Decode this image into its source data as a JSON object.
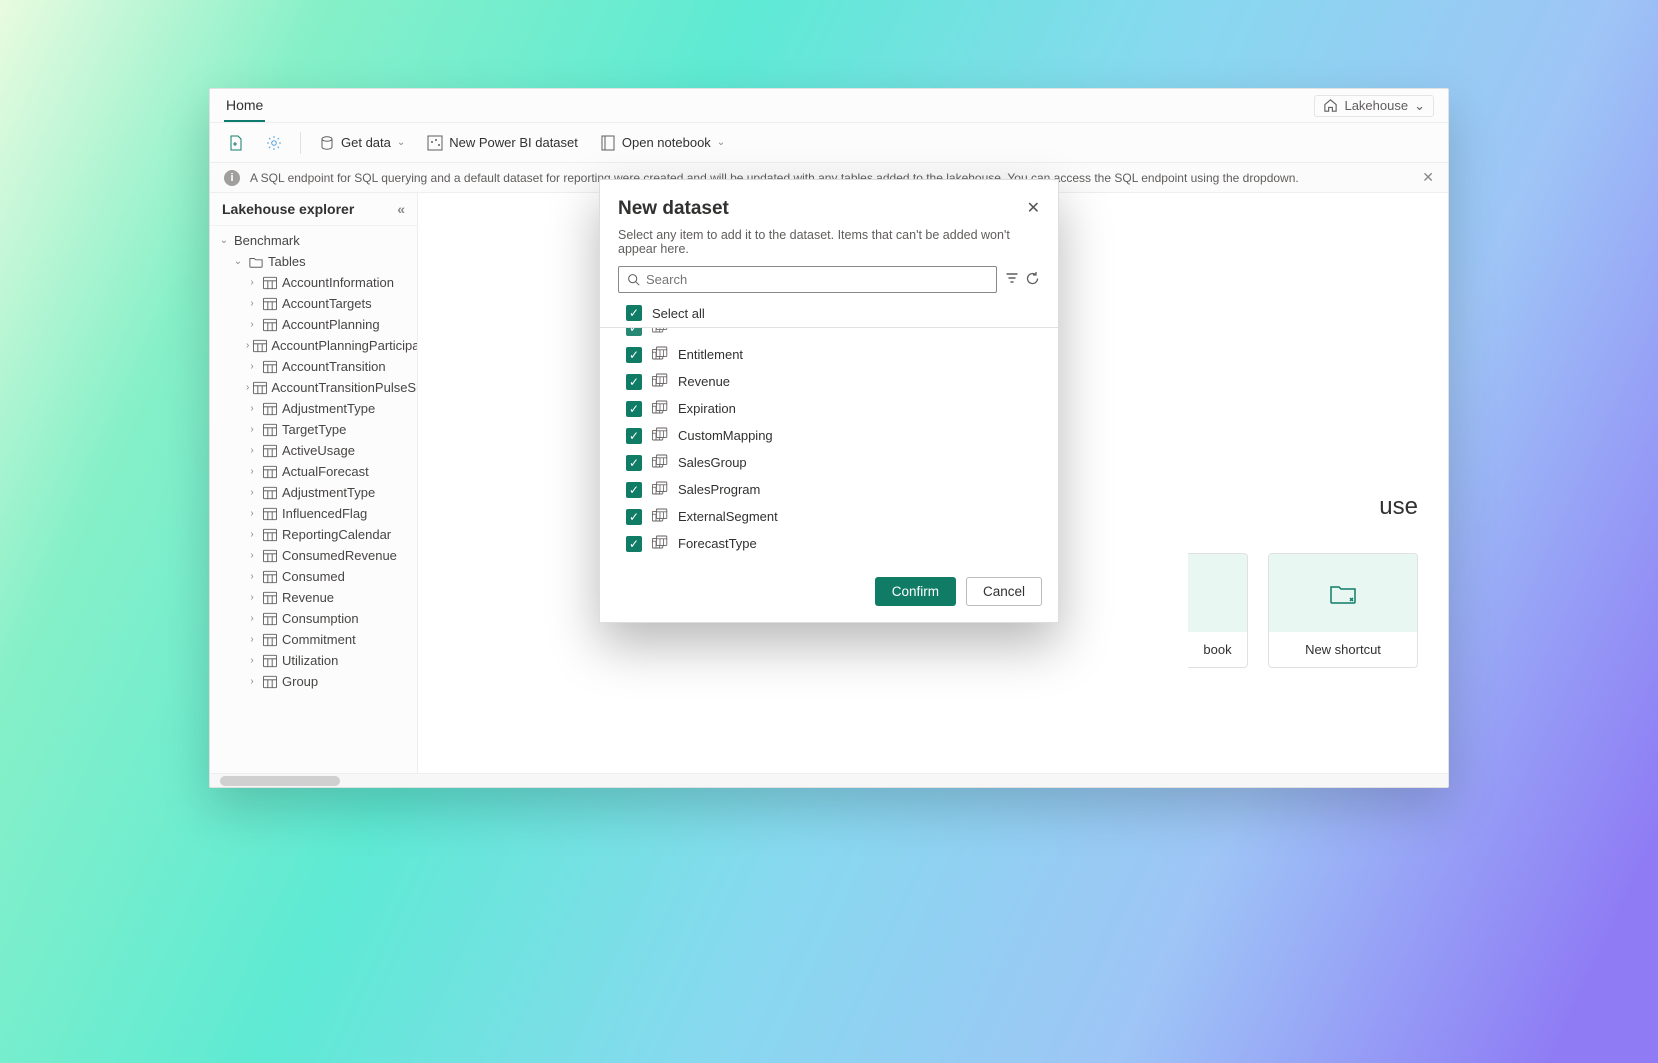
{
  "tabs": {
    "home": "Home"
  },
  "view_switcher": {
    "label": "Lakehouse"
  },
  "toolbar": {
    "get_data": "Get data",
    "new_dataset": "New Power BI dataset",
    "open_notebook": "Open notebook"
  },
  "notice": {
    "text": "A SQL endpoint for SQL querying and a default dataset for reporting were created and will be updated with any tables added to the lakehouse. You can access the SQL endpoint using the dropdown."
  },
  "sidebar": {
    "title": "Lakehouse explorer",
    "root": "Benchmark",
    "folder_tables": "Tables",
    "tables": [
      "AccountInformation",
      "AccountTargets",
      "AccountPlanning",
      "AccountPlanningParticipa",
      "AccountTransition",
      "AccountTransitionPulseSu",
      "AdjustmentType",
      "TargetType",
      "ActiveUsage",
      "ActualForecast",
      "AdjustmentType",
      "InfluencedFlag",
      "ReportingCalendar",
      "ConsumedRevenue",
      "Consumed",
      "Revenue",
      "Consumption",
      "Commitment",
      "Utilization",
      "Group"
    ]
  },
  "canvas": {
    "hero_suffix": "use",
    "cards": {
      "notebook_suffix": "book",
      "shortcut": "New shortcut"
    }
  },
  "modal": {
    "title": "New dataset",
    "subtitle": "Select any item to add it to the dataset. Items that can't be added won't appear here.",
    "search_placeholder": "Search",
    "select_all": "Select all",
    "items": [
      "Entitlement",
      "Revenue",
      "Expiration",
      "CustomMapping",
      "SalesGroup",
      "SalesProgram",
      "ExternalSegment",
      "ForecastType"
    ],
    "confirm": "Confirm",
    "cancel": "Cancel"
  }
}
